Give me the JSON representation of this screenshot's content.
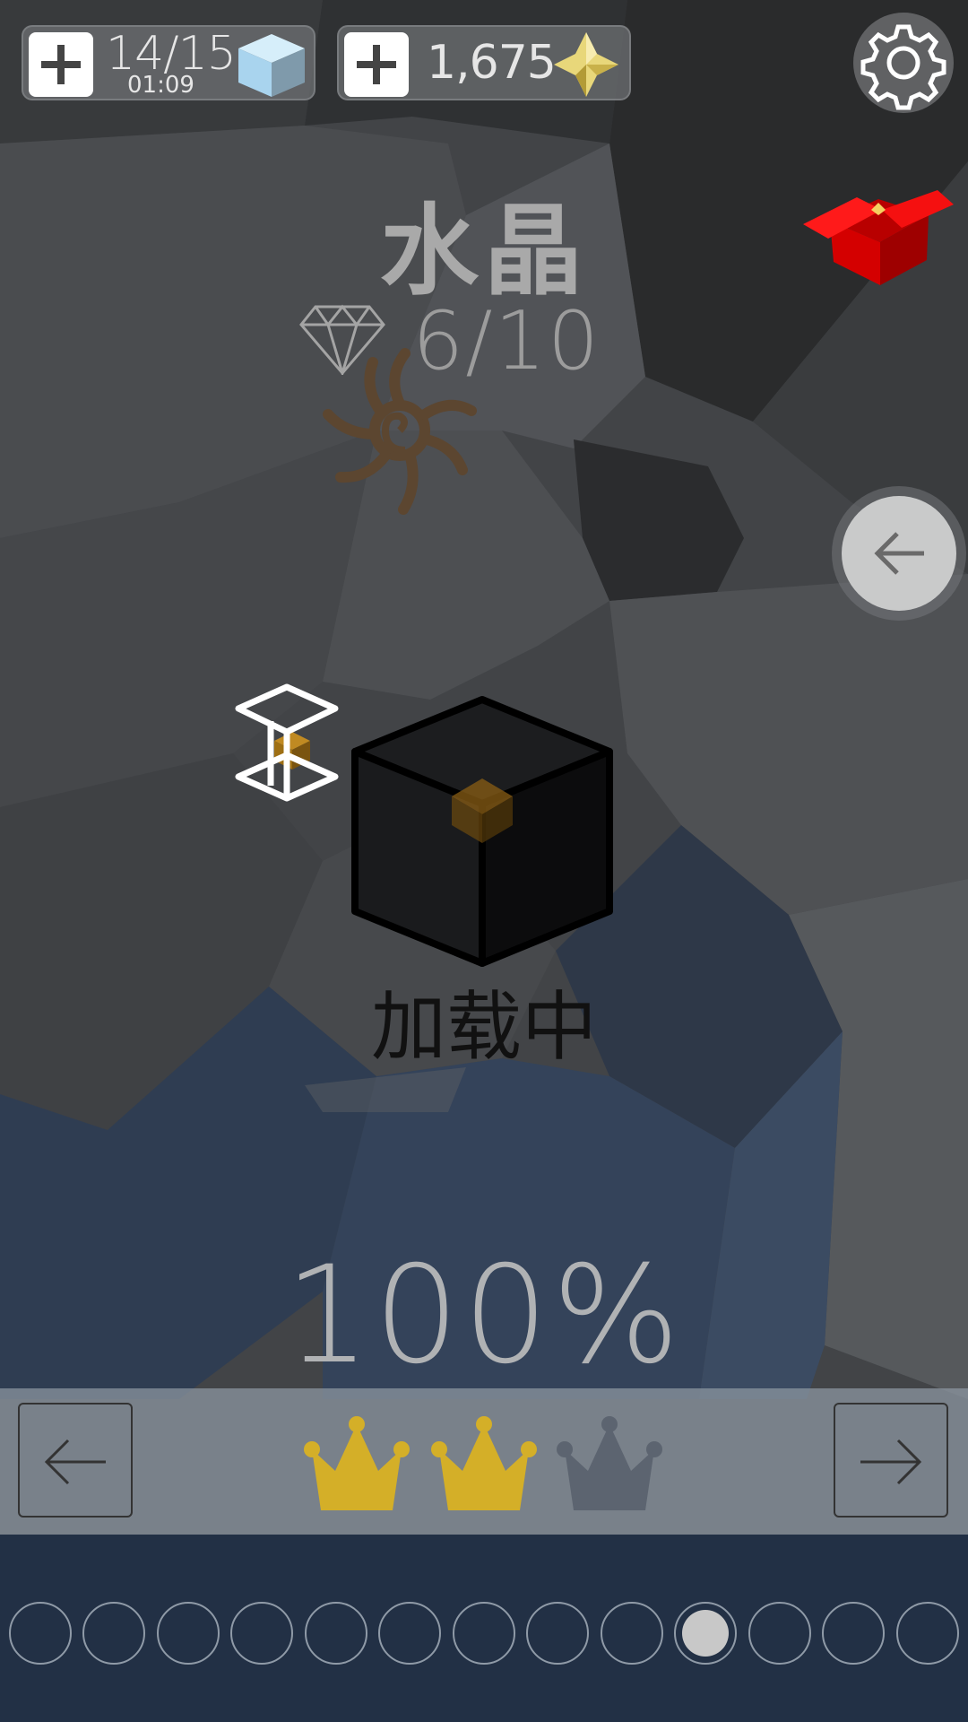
{
  "header": {
    "energy": {
      "count": "14/15",
      "timer": "01:09",
      "icon": "ice-cube-icon",
      "add_icon": "plus-icon"
    },
    "gems": {
      "count": "1,675",
      "icon": "yellow-star-gem-icon",
      "add_icon": "plus-icon"
    },
    "settings_icon": "gear-icon"
  },
  "level": {
    "title": "水晶",
    "collected": "6/10",
    "collected_icon": "diamond-icon",
    "loading_label": "加载中",
    "percent": "100%"
  },
  "gift_icon": "red-gift-box-icon",
  "side_back_icon": "arrow-left-icon",
  "level_nav": {
    "prev_icon": "arrow-left-icon",
    "next_icon": "arrow-right-icon",
    "crowns_earned": 2,
    "crowns_total": 3
  },
  "page_indicator": {
    "count": 13,
    "active_index": 9
  },
  "colors": {
    "crown_gold": "#d4af28",
    "crown_empty": "#5c6470",
    "gift_red": "#e01010"
  }
}
